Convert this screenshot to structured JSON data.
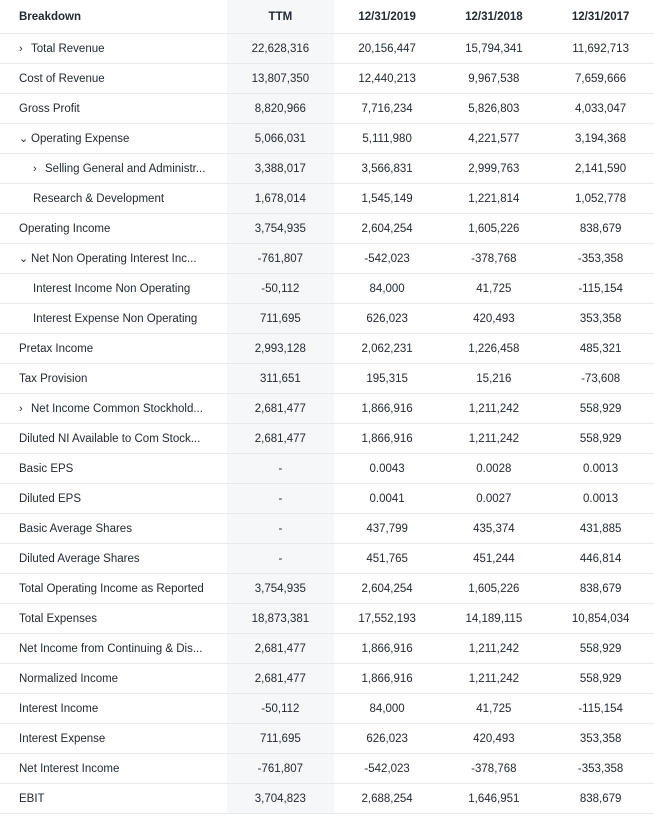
{
  "columns": {
    "breakdown": "Breakdown",
    "periods": [
      "TTM",
      "12/31/2019",
      "12/31/2018",
      "12/31/2017"
    ]
  },
  "rows": [
    {
      "label": "Total Revenue",
      "caret": "›",
      "values": [
        "22,628,316",
        "20,156,447",
        "15,794,341",
        "11,692,713"
      ]
    },
    {
      "label": "Cost of Revenue",
      "values": [
        "13,807,350",
        "12,440,213",
        "9,967,538",
        "7,659,666"
      ]
    },
    {
      "label": "Gross Profit",
      "values": [
        "8,820,966",
        "7,716,234",
        "5,826,803",
        "4,033,047"
      ]
    },
    {
      "label": "Operating Expense",
      "caret": "⌄",
      "values": [
        "5,066,031",
        "5,111,980",
        "4,221,577",
        "3,194,368"
      ]
    },
    {
      "label": "Selling General and Administr...",
      "caret": "›",
      "values": [
        "3,388,017",
        "3,566,831",
        "2,999,763",
        "2,141,590"
      ]
    },
    {
      "label": "Research & Development",
      "values": [
        "1,678,014",
        "1,545,149",
        "1,221,814",
        "1,052,778"
      ]
    },
    {
      "label": "Operating Income",
      "values": [
        "3,754,935",
        "2,604,254",
        "1,605,226",
        "838,679"
      ]
    },
    {
      "label": "Net Non Operating Interest Inc...",
      "caret": "⌄",
      "values": [
        "-761,807",
        "-542,023",
        "-378,768",
        "-353,358"
      ]
    },
    {
      "label": "Interest Income Non Operating",
      "values": [
        "-50,112",
        "84,000",
        "41,725",
        "-115,154"
      ]
    },
    {
      "label": "Interest Expense Non Operating",
      "values": [
        "711,695",
        "626,023",
        "420,493",
        "353,358"
      ]
    },
    {
      "label": "Pretax Income",
      "values": [
        "2,993,128",
        "2,062,231",
        "1,226,458",
        "485,321"
      ]
    },
    {
      "label": "Tax Provision",
      "values": [
        "311,651",
        "195,315",
        "15,216",
        "-73,608"
      ]
    },
    {
      "label": "Net Income Common Stockhold...",
      "caret": "›",
      "values": [
        "2,681,477",
        "1,866,916",
        "1,211,242",
        "558,929"
      ]
    },
    {
      "label": "Diluted NI Available to Com Stock...",
      "values": [
        "2,681,477",
        "1,866,916",
        "1,211,242",
        "558,929"
      ]
    },
    {
      "label": "Basic EPS",
      "values": [
        "-",
        "0.0043",
        "0.0028",
        "0.0013"
      ]
    },
    {
      "label": "Diluted EPS",
      "values": [
        "-",
        "0.0041",
        "0.0027",
        "0.0013"
      ]
    },
    {
      "label": "Basic Average Shares",
      "values": [
        "-",
        "437,799",
        "435,374",
        "431,885"
      ]
    },
    {
      "label": "Diluted Average Shares",
      "values": [
        "-",
        "451,765",
        "451,244",
        "446,814"
      ]
    },
    {
      "label": "Total Operating Income as Reported",
      "values": [
        "3,754,935",
        "2,604,254",
        "1,605,226",
        "838,679"
      ]
    },
    {
      "label": "Total Expenses",
      "values": [
        "18,873,381",
        "17,552,193",
        "14,189,115",
        "10,854,034"
      ]
    },
    {
      "label": "Net Income from Continuing & Dis...",
      "values": [
        "2,681,477",
        "1,866,916",
        "1,211,242",
        "558,929"
      ]
    },
    {
      "label": "Normalized Income",
      "values": [
        "2,681,477",
        "1,866,916",
        "1,211,242",
        "558,929"
      ]
    },
    {
      "label": "Interest Income",
      "values": [
        "-50,112",
        "84,000",
        "41,725",
        "-115,154"
      ]
    },
    {
      "label": "Interest Expense",
      "values": [
        "711,695",
        "626,023",
        "420,493",
        "353,358"
      ]
    },
    {
      "label": "Net Interest Income",
      "values": [
        "-761,807",
        "-542,023",
        "-378,768",
        "-353,358"
      ]
    },
    {
      "label": "EBIT",
      "values": [
        "3,704,823",
        "2,688,254",
        "1,646,951",
        "838,679"
      ]
    }
  ]
}
